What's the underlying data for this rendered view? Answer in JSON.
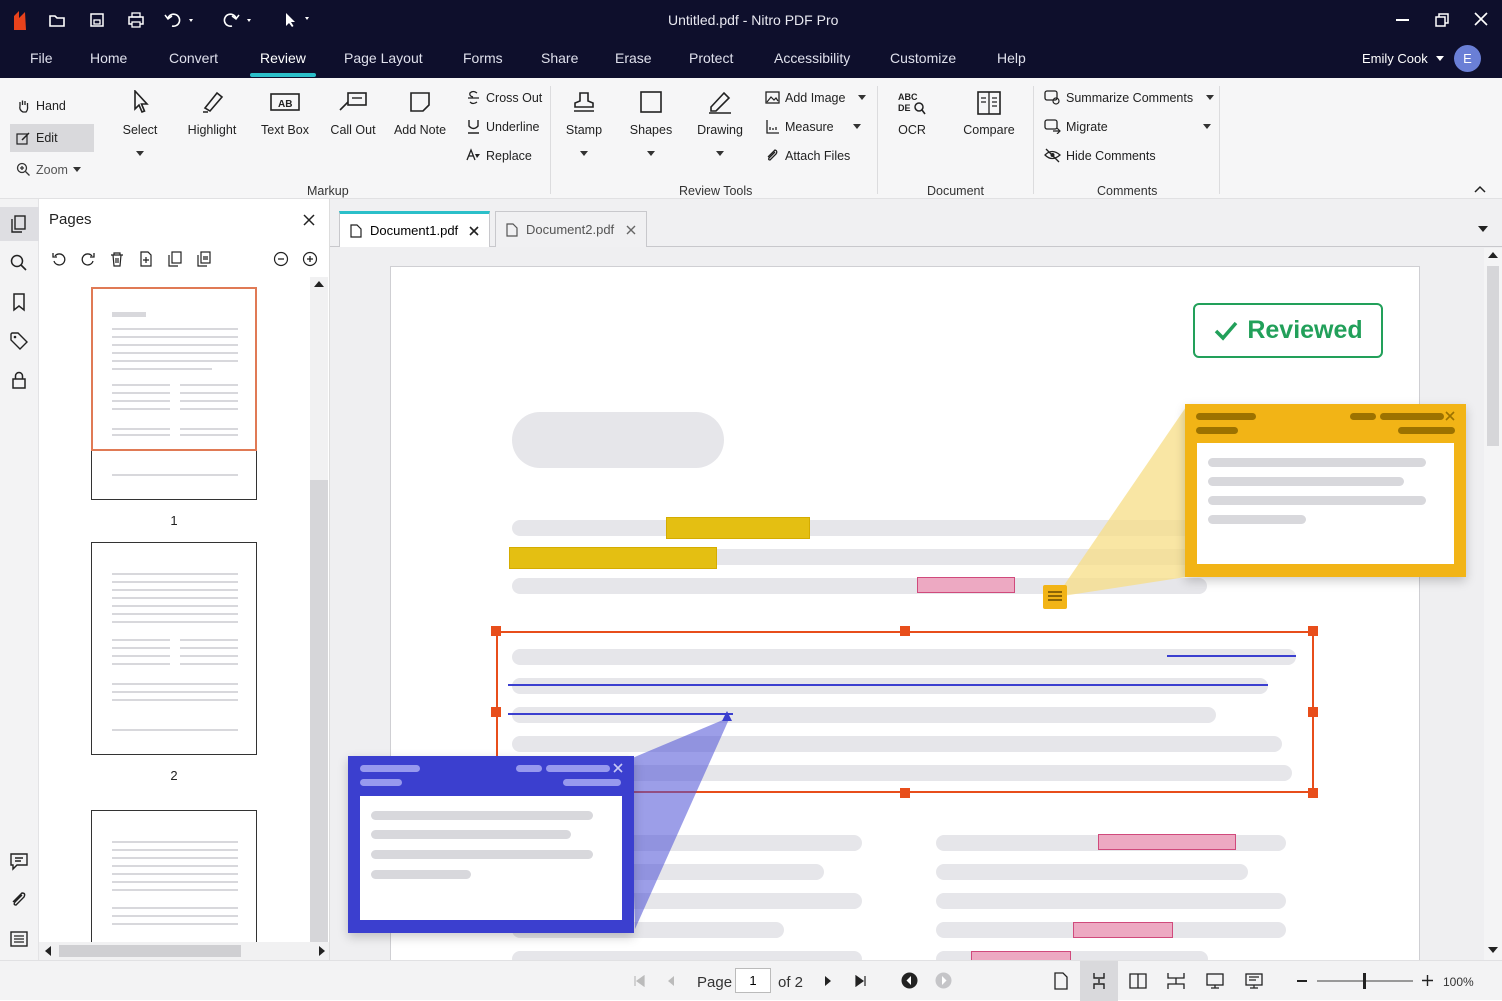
{
  "window": {
    "title": "Untitled.pdf - Nitro PDF Pro"
  },
  "menu": [
    "File",
    "Home",
    "Convert",
    "Review",
    "Page Layout",
    "Forms",
    "Share",
    "Erase",
    "Protect",
    "Accessibility",
    "Customize",
    "Help"
  ],
  "user": {
    "name": "Emily Cook",
    "initial": "E"
  },
  "ribbon": {
    "nav": {
      "hand": "Hand",
      "edit": "Edit",
      "zoom": "Zoom"
    },
    "markup": {
      "select": "Select",
      "highlight": "Highlight",
      "textbox": "Text Box",
      "callout": "Call Out",
      "addnote": "Add Note",
      "crossout": "Cross Out",
      "underline": "Underline",
      "replace": "Replace",
      "group": "Markup"
    },
    "review": {
      "stamp": "Stamp",
      "shapes": "Shapes",
      "drawing": "Drawing",
      "addimage": "Add Image",
      "measure": "Measure",
      "attach": "Attach Files",
      "group": "Review Tools"
    },
    "document": {
      "ocr": "OCR",
      "compare": "Compare",
      "group": "Document"
    },
    "comments": {
      "summarize": "Summarize Comments",
      "migrate": "Migrate",
      "hide": "Hide Comments",
      "group": "Comments"
    }
  },
  "pages_panel": {
    "title": "Pages",
    "thumbs": [
      "1",
      "2"
    ]
  },
  "tabs": [
    {
      "label": "Document1.pdf"
    },
    {
      "label": "Document2.pdf"
    }
  ],
  "stamp": {
    "label": "Reviewed"
  },
  "status": {
    "page_label": "Page",
    "page_value": "1",
    "of": "of 2",
    "zoom": "100%"
  },
  "colors": {
    "accent": "#2bbfc9",
    "titlebar": "#0e0f2c",
    "selection": "#e84e1b",
    "note": "#f2b416",
    "callout": "#3b3fcf",
    "stamp": "#22a05a"
  }
}
